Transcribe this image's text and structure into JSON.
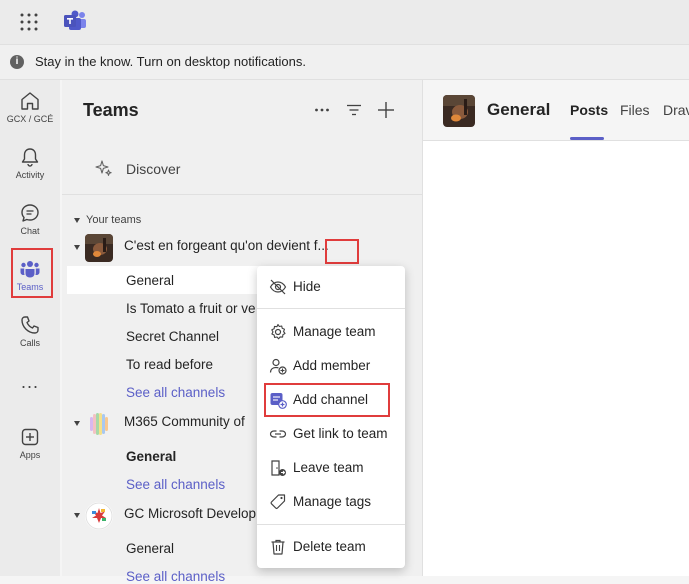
{
  "banner": {
    "text": "Stay in the know. Turn on desktop notifications."
  },
  "rail": {
    "items": [
      {
        "label": "GCX / GCÉ",
        "icon": "home-icon"
      },
      {
        "label": "Activity",
        "icon": "bell-icon"
      },
      {
        "label": "Chat",
        "icon": "chat-icon"
      },
      {
        "label": "Teams",
        "icon": "teams-icon"
      },
      {
        "label": "Calls",
        "icon": "phone-icon"
      },
      {
        "label": "Apps",
        "icon": "add-apps-icon"
      }
    ],
    "more_label": "..."
  },
  "panel": {
    "title": "Teams",
    "discover": "Discover",
    "section": "Your teams",
    "teams": [
      {
        "name": "C'est en forgeant qu'on devient f...",
        "channels": [
          "General",
          "Is Tomato a fruit or ve",
          "Secret Channel",
          "To read before"
        ],
        "see_all": "See all channels"
      },
      {
        "name": "M365 Community of",
        "channels": [
          "General"
        ],
        "see_all": "See all channels"
      },
      {
        "name": "GC Microsoft Develop",
        "channels": [
          "General"
        ],
        "see_all": "See all channels"
      }
    ],
    "more_button": "..."
  },
  "main": {
    "title": "General",
    "tabs": [
      "Posts",
      "Files",
      "Drav"
    ]
  },
  "menu": {
    "items": [
      "Hide",
      "Manage team",
      "Add member",
      "Add channel",
      "Get link to team",
      "Leave team",
      "Manage tags",
      "Delete team"
    ]
  },
  "colors": {
    "accent": "#5b5fc7",
    "highlight": "#e03c3c"
  }
}
